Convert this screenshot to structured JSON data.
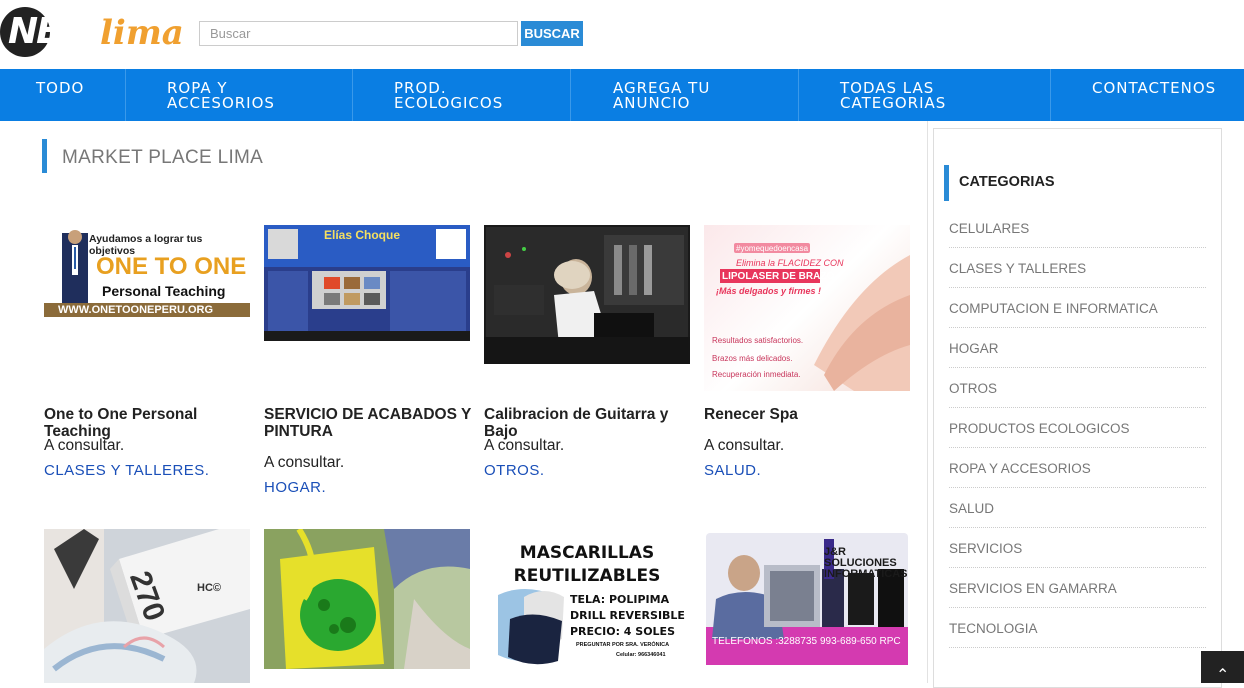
{
  "brand": {
    "net": "NET",
    "lima": "lima",
    "accent": "#f0a030"
  },
  "search": {
    "placeholder": "Buscar",
    "button": "BUSCAR"
  },
  "nav": [
    {
      "label": "TODO"
    },
    {
      "label": "ROPA Y ACCESORIOS"
    },
    {
      "label": "PROD. ECOLOGICOS"
    },
    {
      "label": "AGREGA TU ANUNCIO"
    },
    {
      "label": "TODAS LAS CATEGORIAS"
    },
    {
      "label": "CONTACTENOS"
    }
  ],
  "main": {
    "title": "MARKET PLACE LIMA"
  },
  "products": [
    {
      "name": "One to One Personal Teaching",
      "price": "A consultar.",
      "category": "CLASES Y TALLERES.",
      "image": {
        "top_text": "Ayudamos a lograr tus objetivos",
        "title": "ONE TO ONE",
        "subtitle": "Personal Teaching",
        "url_text": "WWW.ONETOONEPERU.ORG"
      }
    },
    {
      "name": "SERVICIO DE ACABADOS Y PINTURA",
      "price": "A consultar.",
      "category": "HOGAR.",
      "image": {
        "title": "Elías Choque"
      }
    },
    {
      "name": "Calibracion de Guitarra y Bajo",
      "price": "A consultar.",
      "category": "OTROS.",
      "image": {}
    },
    {
      "name": "Renecer Spa",
      "price": "A consultar.",
      "category": "SALUD.",
      "image": {
        "tag": "#yomequedoencasa",
        "line1": "Elimina la FLACIDEZ CON",
        "line2": "LIPOLASER DE BRAZO",
        "line3": "¡Más delgados y firmes !",
        "b1": "Resultados satisfactorios.",
        "b2": "Brazos más delicados.",
        "b3": "Recuperación inmediata."
      }
    },
    {
      "name": "",
      "price": "",
      "category": "",
      "image": {
        "box_text": "270",
        "logo": "HC©"
      }
    },
    {
      "name": "",
      "price": "",
      "category": "",
      "image": {}
    },
    {
      "name": "",
      "price": "",
      "category": "",
      "image": {
        "title1": "MASCARILLAS",
        "title2": "REUTILIZABLES",
        "l1": "TELA: POLIPIMA",
        "l2": "DRILL REVERSIBLE",
        "l3": "PRECIO: 4 SOLES",
        "l4": "PREGUNTAR POR SRA. VERÓNICA",
        "l5": "Celular: 966346041"
      }
    },
    {
      "name": "",
      "price": "",
      "category": "",
      "image": {
        "brand": "J&R SOLUCIONES INFORMATICAS",
        "phone1": "TELEFONOS :3288735",
        "phone2": "993-689-650 RPC"
      }
    }
  ],
  "sidebar": {
    "title": "CATEGORIAS",
    "items": [
      "CELULARES",
      "CLASES Y TALLERES",
      "COMPUTACION E INFORMATICA",
      "HOGAR",
      "OTROS",
      "PRODUCTOS ECOLOGICOS",
      "ROPA Y ACCESORIOS",
      "SALUD",
      "SERVICIOS",
      "SERVICIOS EN GAMARRA",
      "TECNOLOGIA"
    ]
  },
  "scroll_top_icon": "chevron-up-icon"
}
